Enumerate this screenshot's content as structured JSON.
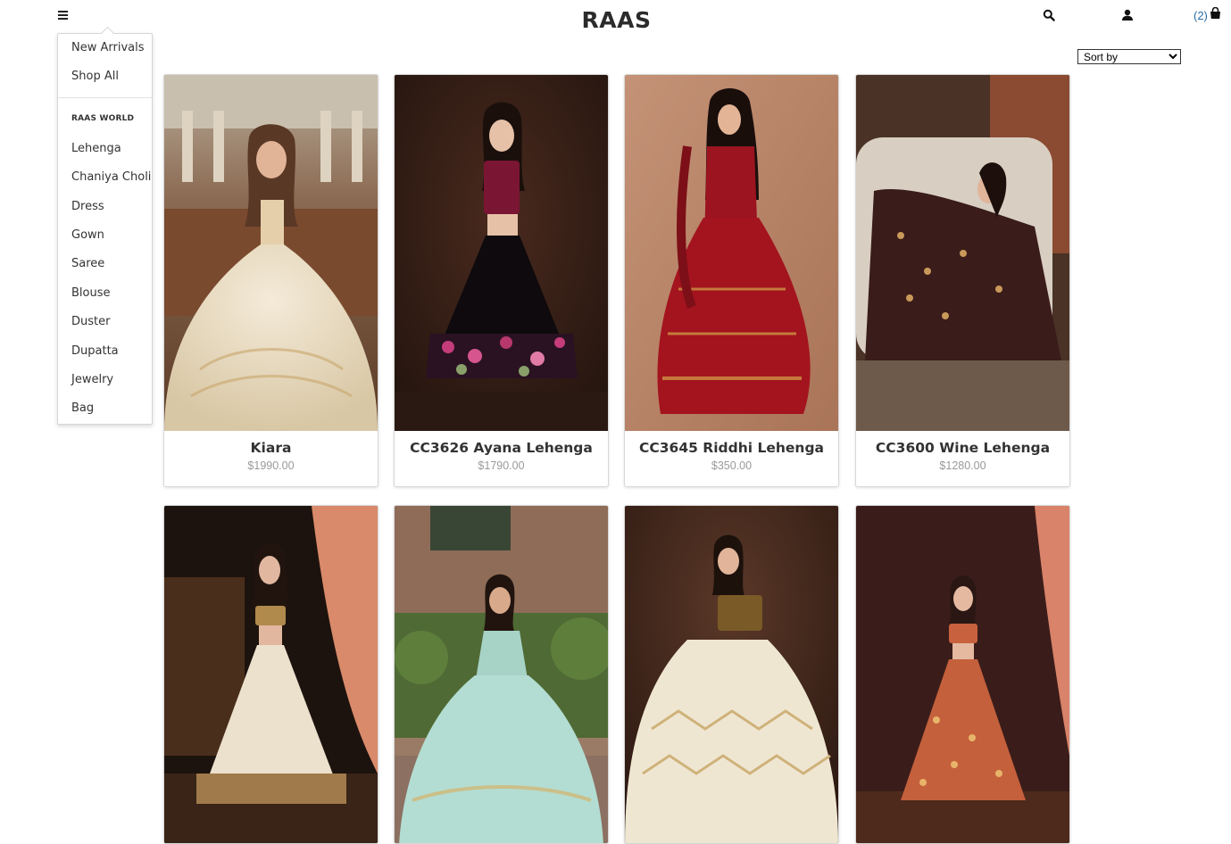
{
  "header": {
    "brand": "RAAS",
    "cart_count": "(2)",
    "icons": [
      "menu-icon",
      "search-icon",
      "user-icon",
      "shopping-bag-icon"
    ]
  },
  "menu": {
    "top_items": [
      "New Arrivals",
      "Shop All"
    ],
    "section_heading": "RAAS WORLD",
    "categories": [
      "Lehenga",
      "Chaniya Choli",
      "Dress",
      "Gown",
      "Saree",
      "Blouse",
      "Duster",
      "Dupatta",
      "Jewelry",
      "Bag"
    ]
  },
  "sort": {
    "selected": "Sort by",
    "options": [
      "Sort by"
    ]
  },
  "products": [
    {
      "name": "Kiara",
      "price": "$1990.00"
    },
    {
      "name": "CC3626 Ayana Lehenga",
      "price": "$1790.00"
    },
    {
      "name": "CC3645 Riddhi Lehenga",
      "price": "$350.00"
    },
    {
      "name": "CC3600 Wine Lehenga",
      "price": "$1280.00"
    },
    {
      "name": "",
      "price": ""
    },
    {
      "name": "",
      "price": ""
    },
    {
      "name": "",
      "price": ""
    },
    {
      "name": "",
      "price": ""
    }
  ],
  "colors": {
    "cart_count": "#2a6ea6",
    "price_text": "#999999",
    "card_border": "#d8d8d8"
  }
}
